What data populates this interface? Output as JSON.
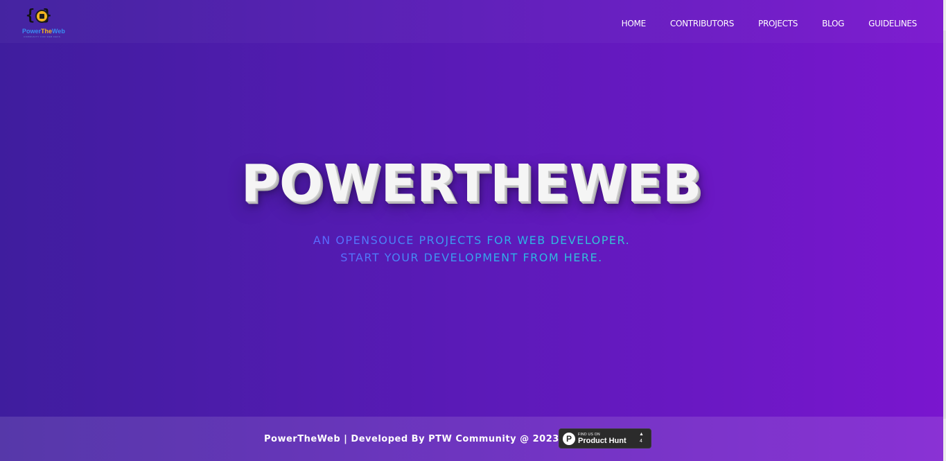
{
  "brand": {
    "logo_braces": "{ }",
    "logo_text_part1": "Power",
    "logo_text_part2": "The",
    "logo_text_part3": "Web",
    "logo_subtext": "COMMUNITY FOR WEB DEVS"
  },
  "nav": {
    "items": [
      {
        "label": "HOME"
      },
      {
        "label": "CONTRIBUTORS"
      },
      {
        "label": "PROJECTS"
      },
      {
        "label": "BLOG"
      },
      {
        "label": "GUIDELINES"
      }
    ]
  },
  "hero": {
    "title": "POWERTHEWEB",
    "tagline_line1": "AN OPENSOUCE PROJECTS FOR WEB DEVELOPER.",
    "tagline_line2": "START YOUR DEVELOPMENT FROM HERE."
  },
  "footer": {
    "text": "PowerTheWeb | Developed By PTW Community @ 2023",
    "badge": {
      "logo_letter": "P",
      "small_text": "FIND US ON",
      "name": "Product Hunt",
      "arrow": "▲",
      "count": "4"
    }
  },
  "colors": {
    "bg_left": "#3f1d9e",
    "bg_right": "#7a16cf",
    "logo_blue": "#3a8df0",
    "logo_gold": "#f4b521",
    "tagline_blue": "#5a6bff",
    "tagline_teal": "#39d0c8"
  }
}
